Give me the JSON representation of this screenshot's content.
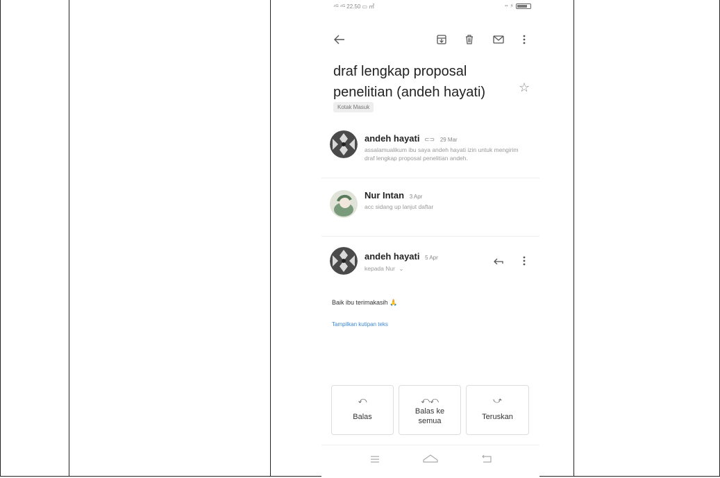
{
  "statusbar": {
    "left_text": "⁴ᴳ ⁴ᴳ 22.50 ▭ ㎡",
    "right_text": "⚡"
  },
  "toolbar": {
    "back_icon": "arrow-left-icon",
    "archive_icon": "archive-icon",
    "delete_icon": "trash-icon",
    "mark_icon": "mail-icon",
    "more_icon": "more-vertical-icon"
  },
  "email": {
    "subject_line1": "draf lengkap proposal",
    "subject_line2": "penelitian (andeh hayati)",
    "label": "Kotak Masuk"
  },
  "messages": [
    {
      "sender": "andeh hayati",
      "date": "29 Mar",
      "snippet": "assalamualikum ibu saya andeh hayati izin untuk mengirim draf lengkap proposal penelitian andeh.",
      "has_attachment": true
    },
    {
      "sender": "Nur Intan",
      "date": "3 Apr",
      "snippet": "acc sidang up lanjut daftar"
    },
    {
      "sender": "andeh hayati",
      "date": "5 Apr",
      "recipient": "kepada Nur",
      "body": "Baik ibu terimakasih 🙏",
      "quote_link": "Tampilkan kutipan teks"
    }
  ],
  "actions": [
    {
      "label": "Balas",
      "icon": "reply-icon"
    },
    {
      "label_line1": "Balas ke",
      "label_line2": "semua",
      "icon": "reply-all-icon"
    },
    {
      "label": "Teruskan",
      "icon": "forward-icon"
    }
  ],
  "navbar": {
    "menu_icon": "menu-icon",
    "home_icon": "home-icon",
    "back_icon": "back-icon"
  }
}
